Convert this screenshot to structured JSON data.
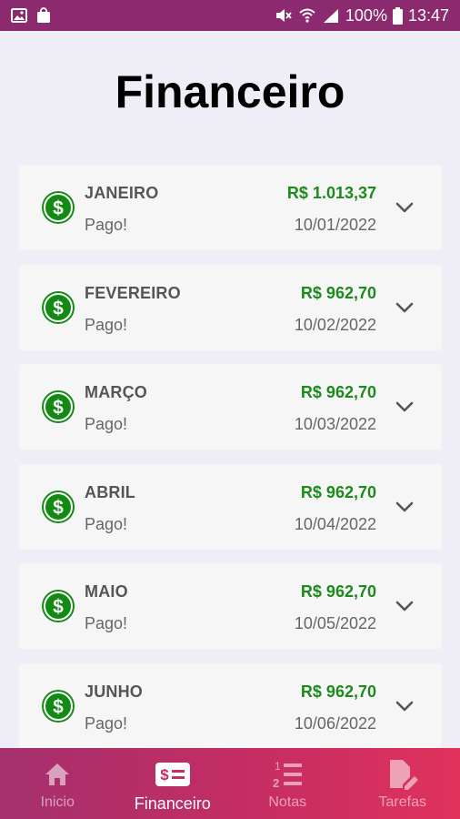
{
  "status_bar": {
    "battery": "100%",
    "time": "13:47"
  },
  "page": {
    "title": "Financeiro"
  },
  "payments": [
    {
      "month": "JANEIRO",
      "status": "Pago!",
      "amount": "R$ 1.013,37",
      "date": "10/01/2022"
    },
    {
      "month": "FEVEREIRO",
      "status": "Pago!",
      "amount": "R$ 962,70",
      "date": "10/02/2022"
    },
    {
      "month": "MARÇO",
      "status": "Pago!",
      "amount": "R$ 962,70",
      "date": "10/03/2022"
    },
    {
      "month": "ABRIL",
      "status": "Pago!",
      "amount": "R$ 962,70",
      "date": "10/04/2022"
    },
    {
      "month": "MAIO",
      "status": "Pago!",
      "amount": "R$ 962,70",
      "date": "10/05/2022"
    },
    {
      "month": "JUNHO",
      "status": "Pago!",
      "amount": "R$ 962,70",
      "date": "10/06/2022"
    }
  ],
  "nav": [
    {
      "label": "Inicio",
      "icon": "home-icon",
      "active": false
    },
    {
      "label": "Financeiro",
      "icon": "money-icon",
      "active": true
    },
    {
      "label": "Notas",
      "icon": "ordered-list-icon",
      "active": false
    },
    {
      "label": "Tarefas",
      "icon": "edit-document-icon",
      "active": false
    }
  ],
  "colors": {
    "status_bar": "#8b2a6f",
    "nav_gradient_start": "#a4306d",
    "nav_gradient_end": "#e0325c",
    "amount_green": "#1d8a1d",
    "coin_green": "#138a13",
    "background": "#efedf6"
  }
}
